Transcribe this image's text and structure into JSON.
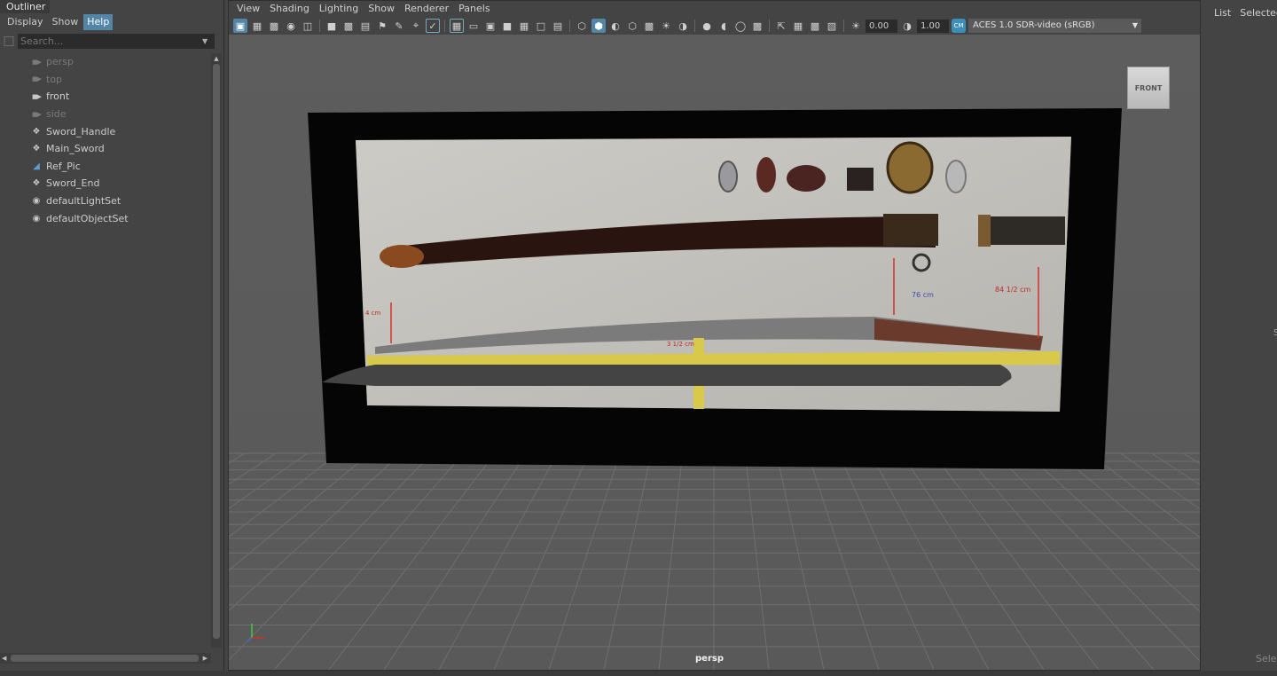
{
  "outliner": {
    "title": "Outliner",
    "menus": [
      "Display",
      "Show",
      "Help"
    ],
    "search_placeholder": "Search...",
    "items": [
      {
        "label": "persp",
        "icon": "camera-icon",
        "dim": true
      },
      {
        "label": "top",
        "icon": "camera-icon",
        "dim": true
      },
      {
        "label": "front",
        "icon": "camera-icon",
        "dim": false
      },
      {
        "label": "side",
        "icon": "camera-icon",
        "dim": true
      },
      {
        "label": "Sword_Handle",
        "icon": "transform-icon",
        "dim": false
      },
      {
        "label": "Main_Sword",
        "icon": "transform-icon",
        "dim": false
      },
      {
        "label": "Ref_Pic",
        "icon": "image-plane-icon",
        "dim": false
      },
      {
        "label": "Sword_End",
        "icon": "transform-icon",
        "dim": false
      },
      {
        "label": "defaultLightSet",
        "icon": "set-icon",
        "dim": false
      },
      {
        "label": "defaultObjectSet",
        "icon": "set-icon",
        "dim": false
      }
    ]
  },
  "viewport": {
    "menus": [
      "View",
      "Shading",
      "Lighting",
      "Show",
      "Renderer",
      "Panels"
    ],
    "exposure": "0.00",
    "gamma": "1.00",
    "color_space": "ACES 1.0 SDR-video (sRGB)",
    "viewcube_label": "FRONT",
    "camera_label": "persp",
    "reference_annotations": [
      "76 cm",
      "84 1/2 cm",
      "4 cm",
      "3 1/2 cm"
    ]
  },
  "channel_box": {
    "menus": [
      "List",
      "Selected"
    ],
    "bottom_text": "Sele",
    "side_mark": "S"
  },
  "colors": {
    "accent": "#5285a6",
    "panel_bg": "#444444",
    "field_bg": "#2b2b2b",
    "viewport_bg": "#5b5b5b",
    "grid_line": "#6f6f6f"
  }
}
